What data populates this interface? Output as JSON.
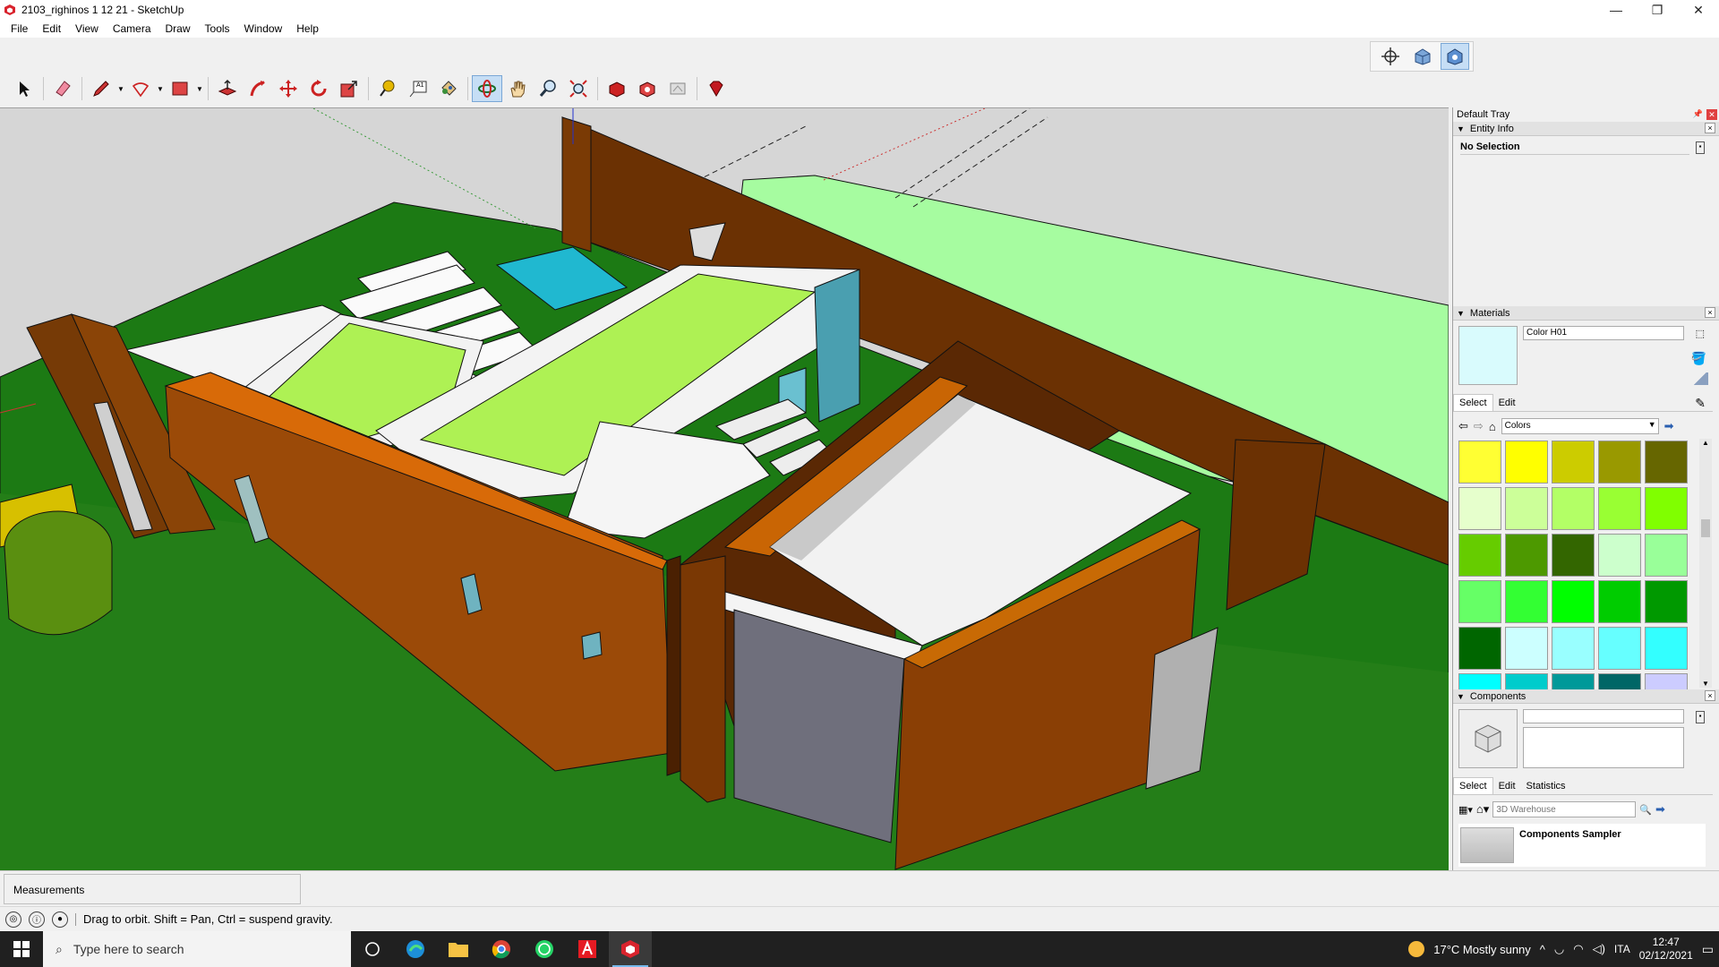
{
  "window": {
    "title": "2103_righinos 1 12 21 - SketchUp",
    "minimize": "—",
    "restore": "❐",
    "close": "✕"
  },
  "menu": [
    "File",
    "Edit",
    "View",
    "Camera",
    "Draw",
    "Tools",
    "Window",
    "Help"
  ],
  "toolbar": {
    "tools": [
      "select-tool",
      "eraser-tool",
      "line-tool",
      "arc-tool",
      "shape-tool",
      "push-pull-tool",
      "follow-me-tool",
      "move-tool",
      "rotate-tool",
      "scale-tool",
      "tape-measure-tool",
      "text-tool",
      "paint-bucket-tool",
      "orbit-tool",
      "pan-tool",
      "zoom-tool",
      "zoom-extents-tool",
      "3d-warehouse",
      "extension-warehouse",
      "layout",
      "ruby-console"
    ],
    "text_tool_label": "A1"
  },
  "tray": {
    "title": "Default Tray",
    "entity_info": {
      "header": "Entity Info",
      "value": "No Selection"
    },
    "materials": {
      "header": "Materials",
      "current_name": "Color H01",
      "current_color": "#d9fbfd",
      "tab_select": "Select",
      "tab_edit": "Edit",
      "collection": "Colors",
      "swatches": [
        "#ffff33",
        "#ffff00",
        "#cccc00",
        "#999900",
        "#666600",
        "#e6ffcc",
        "#ccff99",
        "#b3ff66",
        "#99ff33",
        "#80ff00",
        "#66cc00",
        "#4d9900",
        "#336600",
        "#ccffcc",
        "#99ff99",
        "#66ff66",
        "#33ff33",
        "#00ff00",
        "#00cc00",
        "#009900",
        "#006600",
        "#ccffff",
        "#99ffff",
        "#66ffff",
        "#33ffff",
        "#00ffff",
        "#00cccc",
        "#009999",
        "#006666",
        "#ccccff"
      ]
    },
    "components": {
      "header": "Components",
      "tab_select": "Select",
      "tab_edit": "Edit",
      "tab_statistics": "Statistics",
      "search_placeholder": "3D Warehouse",
      "sampler_title": "Components Sampler"
    }
  },
  "measurements": {
    "label": "Measurements"
  },
  "status": {
    "hint": "Drag to orbit. Shift = Pan, Ctrl = suspend gravity."
  },
  "taskbar": {
    "search_placeholder": "Type here to search",
    "weather": "17°C  Mostly sunny",
    "language": "ITA",
    "time": "12:47",
    "date": "02/12/2021"
  }
}
